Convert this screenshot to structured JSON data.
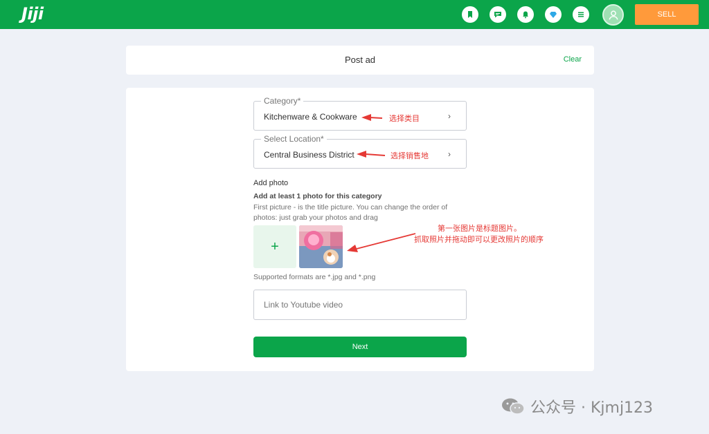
{
  "header": {
    "logo": "Jiji",
    "icons": [
      "bookmark-icon",
      "chat-icon",
      "bell-icon",
      "diamond-icon",
      "list-icon"
    ],
    "sell_label": "SELL",
    "brand_color": "#0ba54a",
    "sell_color": "#ff9a3b"
  },
  "title_card": {
    "title": "Post ad",
    "clear_label": "Clear"
  },
  "form": {
    "category": {
      "label": "Category*",
      "value": "Kitchenware & Cookware"
    },
    "location": {
      "label": "Select Location*",
      "value": "Central Business District"
    },
    "photo": {
      "label": "Add photo",
      "hint": "Add at least 1 photo for this category",
      "description": "First picture - is the title picture. You can change the order of photos: just grab your photos and drag",
      "add_symbol": "+",
      "formats": "Supported formats are *.jpg and *.png"
    },
    "youtube": {
      "placeholder": "Link to Youtube video"
    },
    "next_label": "Next"
  },
  "annotations": {
    "category_note": "选择类目",
    "location_note": "选择销售地",
    "photo_note_line1": "第一张图片是标题图片。",
    "photo_note_line2": "抓取照片并拖动即可以更改照片的顺序",
    "color": "#e53935"
  },
  "watermark": {
    "text": "公众号 · Kjmj123"
  }
}
